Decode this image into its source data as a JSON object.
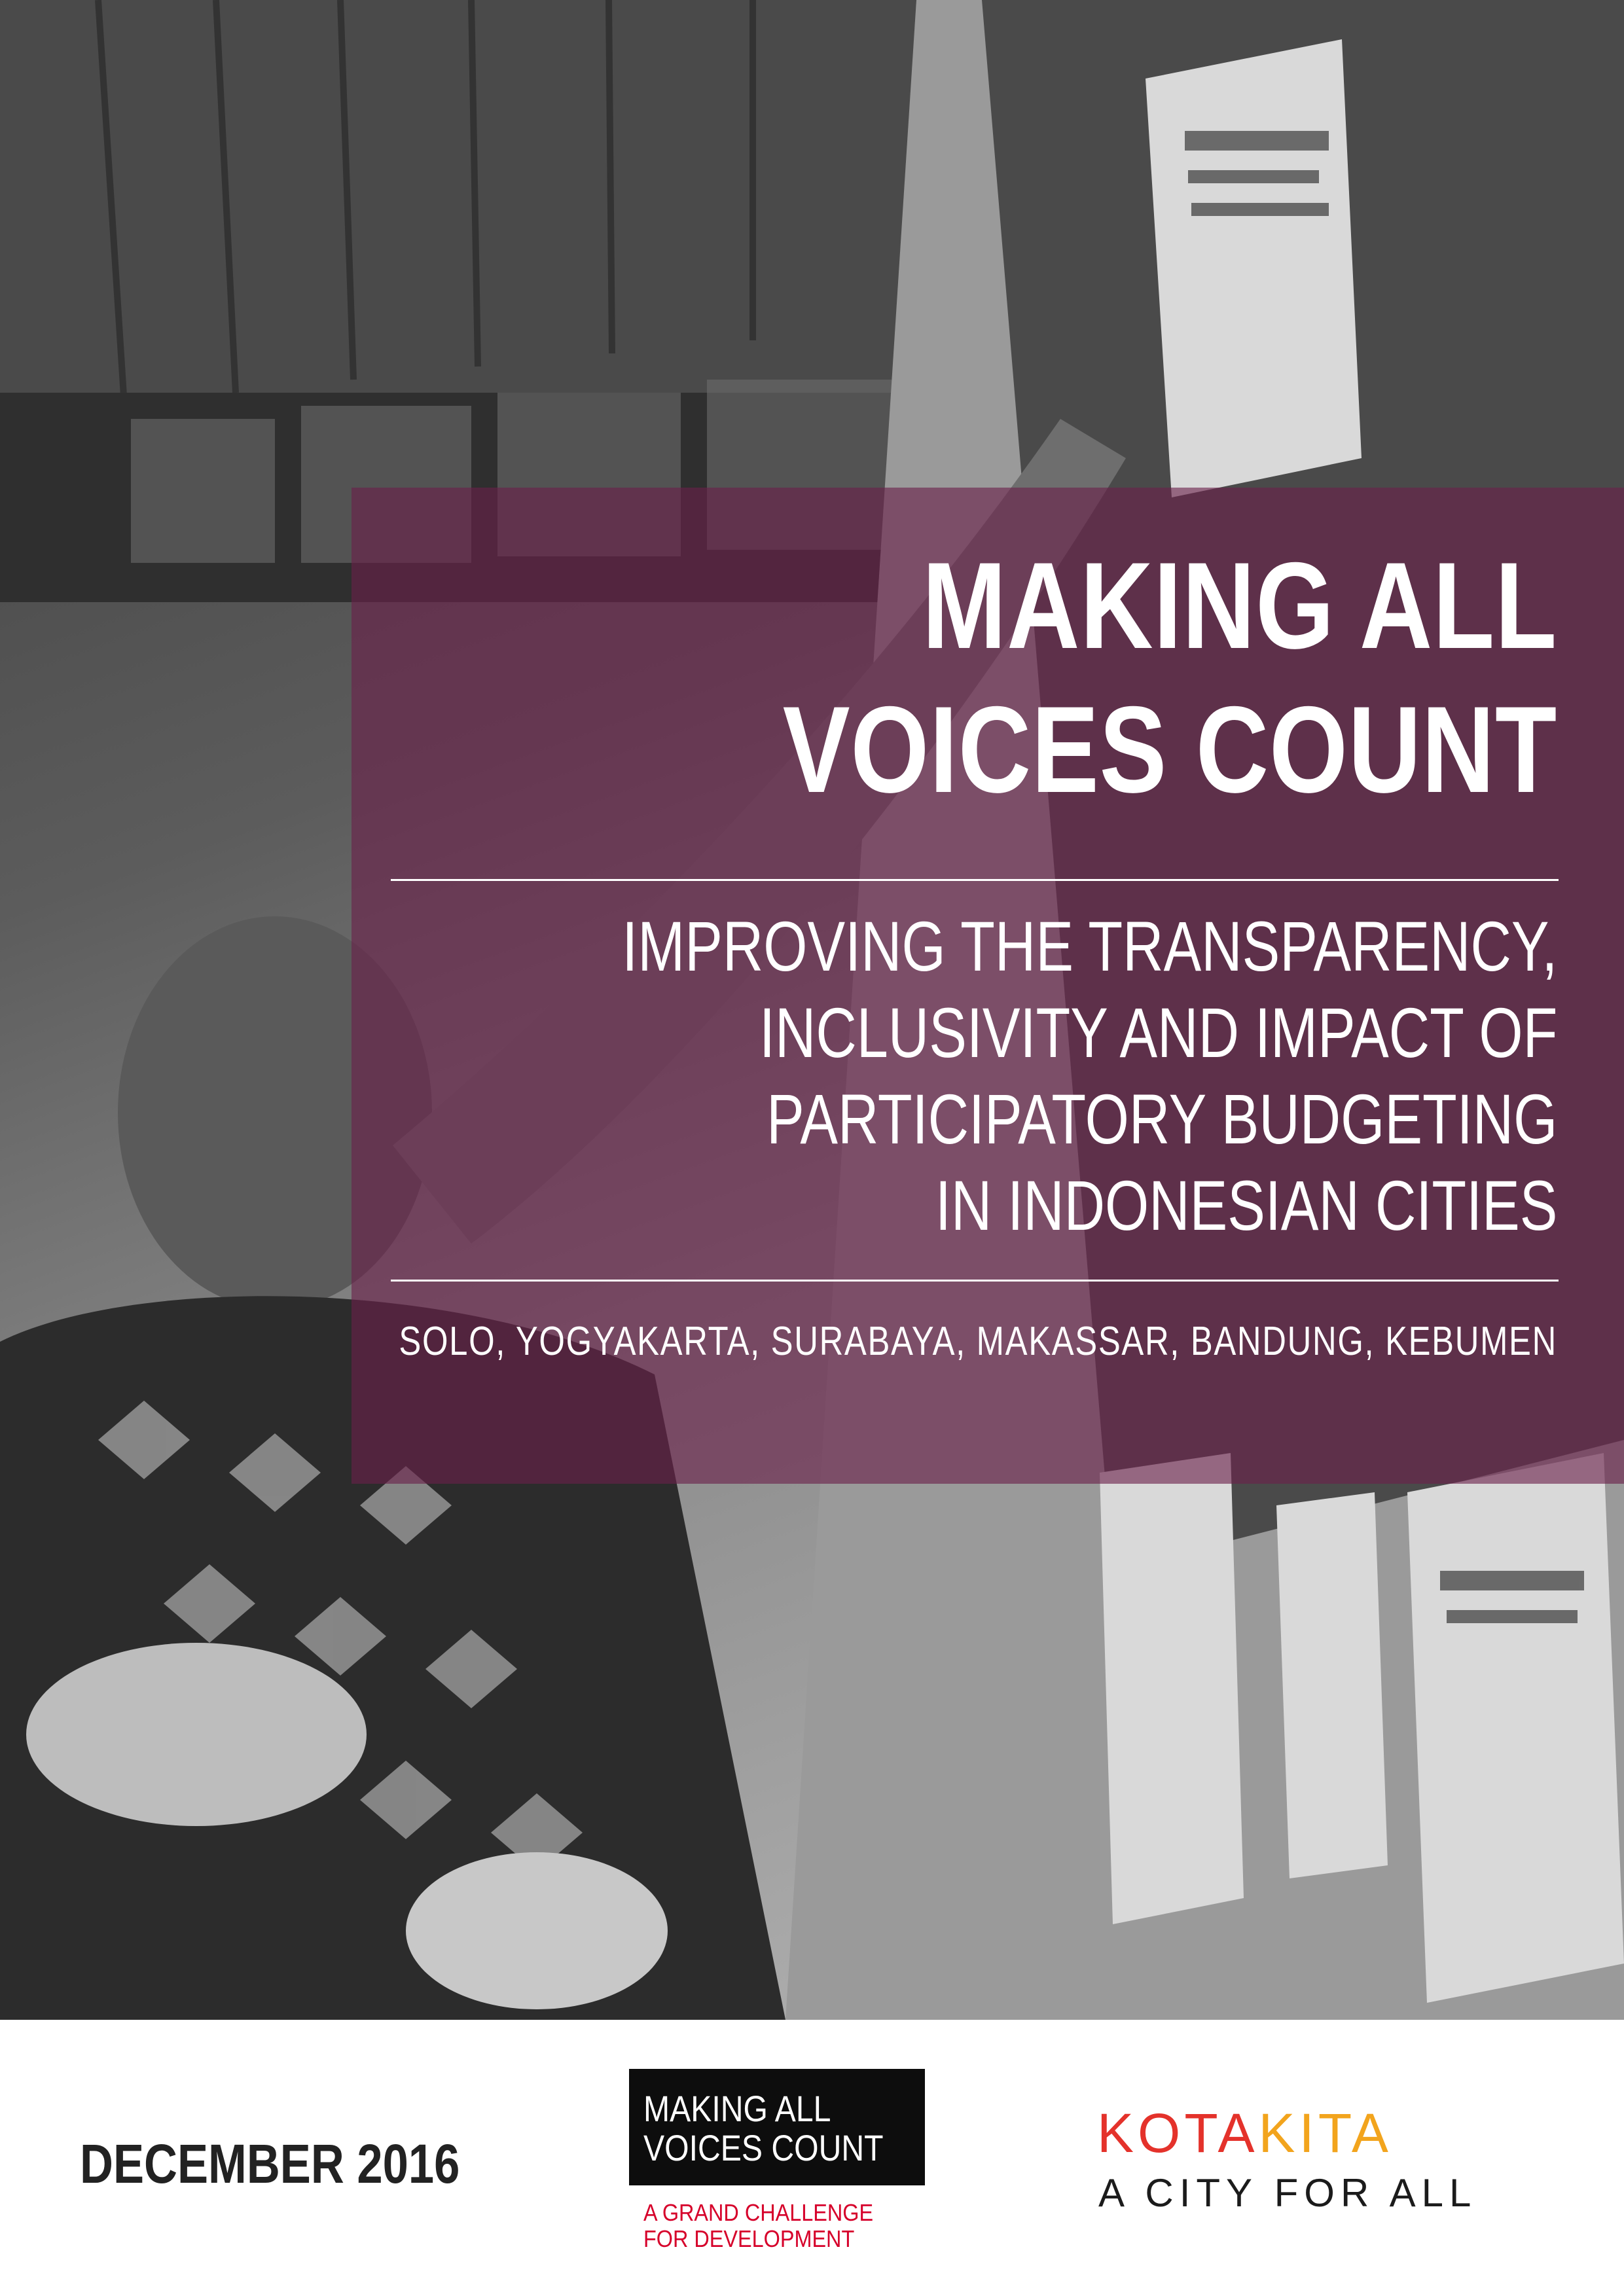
{
  "cover": {
    "title_line1": "MAKING ALL",
    "title_line2": "VOICES COUNT",
    "subtitle_lines": [
      "IMPROVING THE TRANSPARENCY,",
      "INCLUSIVITY AND IMPACT OF",
      "PARTICIPATORY BUDGETING",
      "IN INDONESIAN CITIES"
    ],
    "cities": "SOLO, YOGYAKARTA, SURABAYA, MAKASSAR, BANDUNG, KEBUMEN",
    "panel_color": "#6a204a"
  },
  "footer": {
    "date": "DECEMBER 2016",
    "mavc_logo": {
      "line1": "MAKING ALL",
      "line2": "VOICES COUNT",
      "tagline1": "A GRAND CHALLENGE",
      "tagline2": "FOR DEVELOPMENT",
      "tag_color": "#d6002a"
    },
    "kotakita_logo": {
      "part1": "KOTA",
      "part2": "KITA",
      "tagline": "A CITY FOR ALL",
      "color1": "#e4322b",
      "color2": "#f2a41d"
    }
  }
}
